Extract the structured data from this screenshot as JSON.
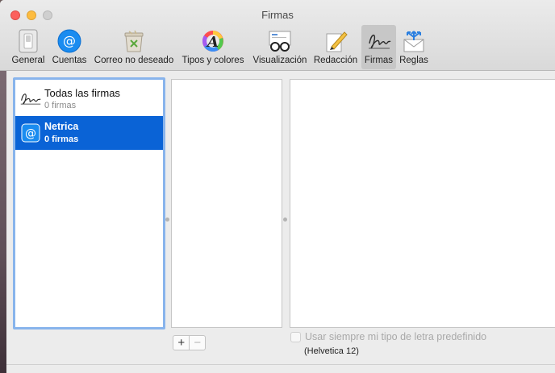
{
  "window": {
    "title": "Firmas"
  },
  "toolbar": {
    "items": [
      {
        "label": "General",
        "icon": "switch-icon"
      },
      {
        "label": "Cuentas",
        "icon": "at-sign-icon"
      },
      {
        "label": "Correo no deseado",
        "icon": "junk-bin-icon"
      },
      {
        "label": "Tipos y colores",
        "icon": "font-color-wheel-icon"
      },
      {
        "label": "Visualización",
        "icon": "glasses-icon"
      },
      {
        "label": "Redacción",
        "icon": "pencil-paper-icon"
      },
      {
        "label": "Firmas",
        "icon": "signature-icon"
      },
      {
        "label": "Reglas",
        "icon": "rules-envelope-icon"
      }
    ],
    "selected": "Firmas"
  },
  "accounts": [
    {
      "name": "Todas las firmas",
      "count": "0 firmas",
      "icon": "signature-icon",
      "selected": false
    },
    {
      "name": "Netrica",
      "count": "0 firmas",
      "icon": "at-sign-icon",
      "selected": true
    }
  ],
  "buttons": {
    "add": "+",
    "remove": "−"
  },
  "options": {
    "use_default_font": "Usar siempre mi tipo de letra predefinido",
    "font_note": "(Helvetica 12)"
  },
  "colors": {
    "selection": "#0a63d6",
    "focus_ring": "#88b4ec"
  }
}
